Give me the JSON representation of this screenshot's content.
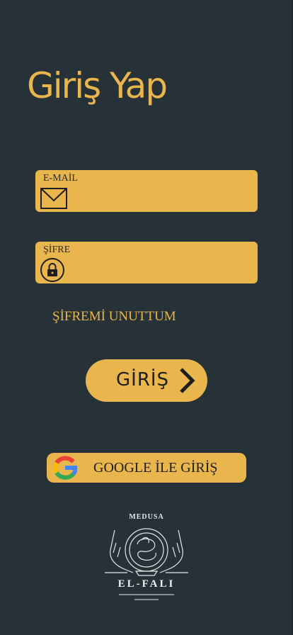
{
  "title": "Giriş Yap",
  "email": {
    "label": "E-MAİL",
    "value": "",
    "icon": "envelope-icon"
  },
  "password": {
    "label": "ŞİFRE",
    "value": "",
    "icon": "lock-icon"
  },
  "forgot_label": "ŞİFREMİ UNUTTUM",
  "login_label": "GİRİŞ",
  "google_label": "GOOGLE İLE GİRİŞ",
  "logo": {
    "top_text": "MEDUSA",
    "bottom_text": "EL-FALI"
  },
  "colors": {
    "background": "#263238",
    "accent": "#e8b64c",
    "text_dark": "#1e1e1e"
  }
}
